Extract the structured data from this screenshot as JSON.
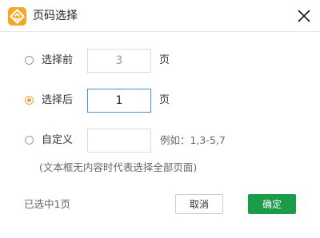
{
  "window": {
    "title": "页码选择",
    "colors": {
      "accent": "#f0a03c",
      "primary": "#1a9c48",
      "focus": "#4a90d9"
    }
  },
  "options": {
    "before": {
      "label": "选择前",
      "value": "3",
      "unit": "页",
      "checked": false
    },
    "after": {
      "label": "选择后",
      "value": "1",
      "unit": "页",
      "checked": true
    },
    "custom": {
      "label": "自定义",
      "value": "",
      "example": "例如：1,3-5,7",
      "checked": false
    }
  },
  "hint": "(文本框无内容时代表选择全部页面)",
  "status": "已选中1页",
  "buttons": {
    "cancel": "取消",
    "ok": "确定"
  }
}
